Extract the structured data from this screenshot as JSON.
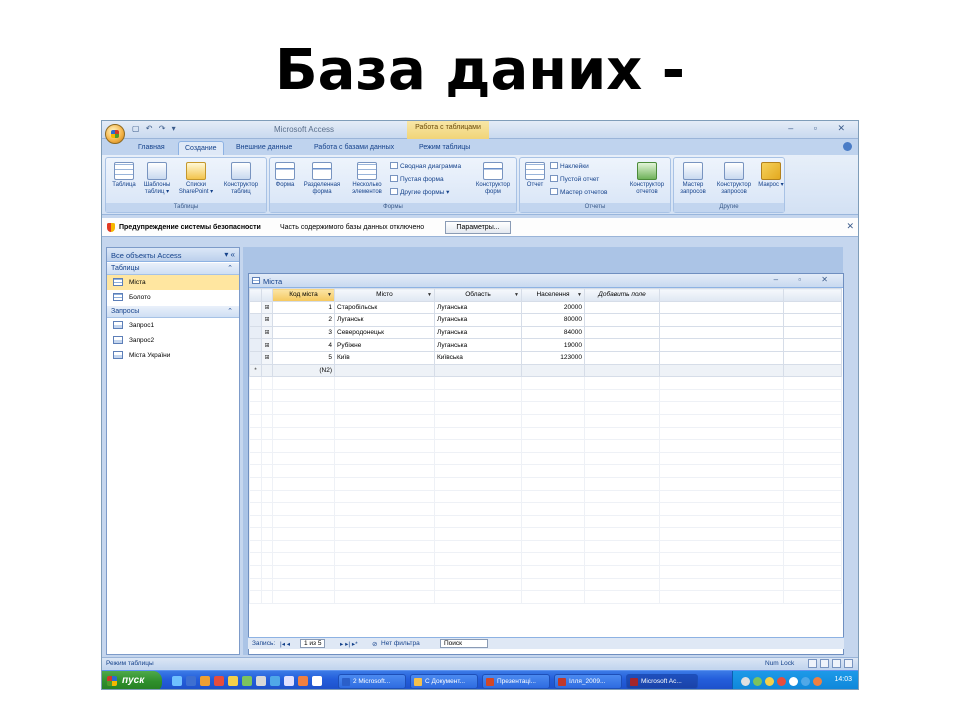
{
  "slide": {
    "title": "База даних -"
  },
  "window": {
    "title": "Microsoft Access",
    "context_tab": "Работа с таблицами",
    "qat": "▢ ↶ ↷ ▾",
    "controls": "– ▫ ✕"
  },
  "tabs": [
    "Главная",
    "Создание",
    "Внешние данные",
    "Работа с базами данных",
    "Режим таблицы"
  ],
  "ribbon": {
    "groups": {
      "tables": {
        "label": "Таблицы",
        "buttons": [
          "Таблица",
          "Шаблоны таблиц ▾",
          "Списки SharePoint ▾",
          "Конструктор таблиц"
        ]
      },
      "forms": {
        "label": "Формы",
        "buttons": [
          "Форма",
          "Разделенная форма",
          "Несколько элементов",
          "Конструктор форм"
        ],
        "small": [
          "Сводная диаграмма",
          "Пустая форма",
          "Другие формы ▾"
        ]
      },
      "reports": {
        "label": "Отчеты",
        "buttons": [
          "Отчет",
          "Конструктор отчетов"
        ],
        "small": [
          "Наклейки",
          "Пустой отчет",
          "Мастер отчетов"
        ]
      },
      "other": {
        "label": "Другие",
        "buttons": [
          "Мастер запросов",
          "Конструктор запросов",
          "Макрос ▾"
        ]
      }
    }
  },
  "security_bar": {
    "title": "Предупреждение системы безопасности",
    "message": "Часть содержимого базы данных отключено",
    "button": "Параметры..."
  },
  "nav": {
    "header": "Все объекты Access",
    "sections": [
      {
        "label": "Таблицы",
        "items": [
          "Міста",
          "Болото"
        ]
      },
      {
        "label": "Запросы",
        "items": [
          "Запрос1",
          "Запрос2",
          "Міста України"
        ]
      }
    ]
  },
  "document": {
    "title": "Міста",
    "columns": [
      "Код міста",
      "Місто",
      "Область",
      "Населення",
      "Добавить поле"
    ],
    "rows": [
      {
        "id": "1",
        "city": "Старобільськ",
        "region": "Луганська",
        "population": "20000"
      },
      {
        "id": "2",
        "city": "Луганськ",
        "region": "Луганська",
        "population": "80000"
      },
      {
        "id": "3",
        "city": "Северодонецьк",
        "region": "Луганська",
        "population": "84000"
      },
      {
        "id": "4",
        "city": "Рубіжне",
        "region": "Луганська",
        "population": "19000"
      },
      {
        "id": "5",
        "city": "Київ",
        "region": "Київська",
        "population": "123000"
      }
    ],
    "new_row_marker": "*",
    "new_row_id": "(N2)",
    "record_nav": {
      "label": "Запись:",
      "position": "1 из 5",
      "filter": "Нет фильтра",
      "search": "Поиск"
    }
  },
  "status_bar": {
    "left": "Режим таблицы",
    "right": "Num Lock"
  },
  "taskbar": {
    "start": "пуск",
    "tasks": [
      "2 Microsoft...",
      "С Документ...",
      "Презентаці...",
      "Ілля_2009...",
      "Microsoft Ac..."
    ],
    "clock": "14:03"
  }
}
